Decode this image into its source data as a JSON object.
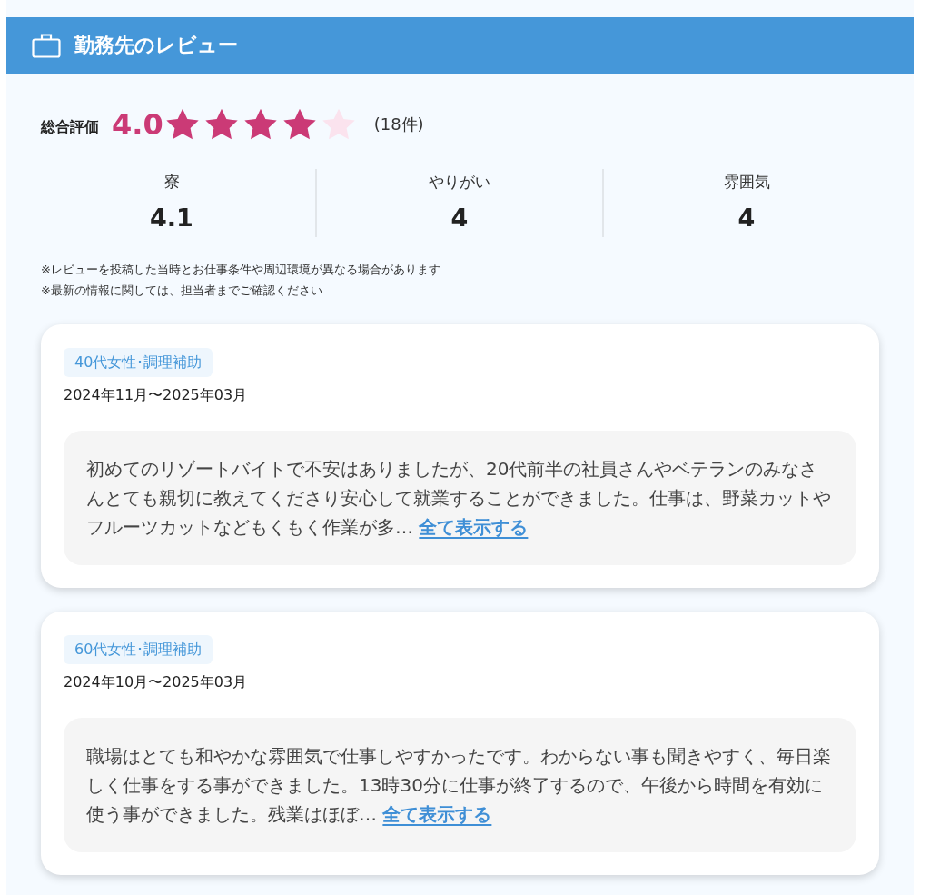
{
  "header": {
    "title": "勤務先のレビュー"
  },
  "overall": {
    "label": "総合評価",
    "score": "4.0",
    "stars": 4,
    "count": "(18件)"
  },
  "categories": [
    {
      "label": "寮",
      "score": "4.1"
    },
    {
      "label": "やりがい",
      "score": "4"
    },
    {
      "label": "雰囲気",
      "score": "4"
    }
  ],
  "notes": [
    "※レビューを投稿した当時とお仕事条件や周辺環境が異なる場合があります",
    "※最新の情報に関しては、担当者までご確認ください"
  ],
  "reviews": [
    {
      "tag": "40代女性･調理補助",
      "period": "2024年11月〜2025年03月",
      "text": "初めてのリゾートバイトで不安はありましたが、20代前半の社員さんやベテランのみなさんとても親切に教えてくださり安心して就業することができました。仕事は、野菜カットやフルーツカットなどもくもく作業が多…",
      "link": "全て表示する"
    },
    {
      "tag": "60代女性･調理補助",
      "period": "2024年10月〜2025年03月",
      "text": "職場はとても和やかな雰囲気で仕事しやすかったです。わからない事も聞きやすく、毎日楽しく仕事をする事ができました。13時30分に仕事が終了するので、午後から時間を有効に使う事ができました。残業はほぼ…",
      "link": "全て表示する"
    }
  ]
}
